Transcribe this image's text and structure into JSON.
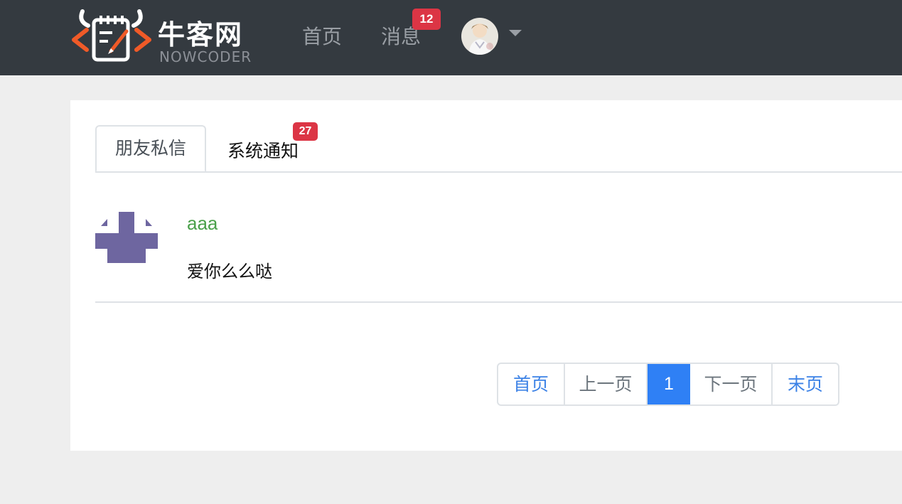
{
  "brand": {
    "name_cn": "牛客网",
    "name_en": "NOWCODER",
    "colors": {
      "orange": "#f05a28",
      "white": "#ffffff"
    }
  },
  "nav": {
    "home_label": "首页",
    "messages_label": "消息",
    "messages_badge": "12"
  },
  "tabs": {
    "letters_label": "朋友私信",
    "notices_label": "系统通知",
    "notices_badge": "27"
  },
  "messages": [
    {
      "user": "aaa",
      "content": "爱你么么哒"
    }
  ],
  "pagination": {
    "first": "首页",
    "prev": "上一页",
    "current": "1",
    "next": "下一页",
    "last": "末页"
  },
  "colors": {
    "navbar_bg": "#343a40",
    "page_bg": "#eeeeee",
    "badge": "#dc3545",
    "link_blue": "#3c82e6",
    "active_page": "#2f80f5",
    "username_green": "#4aa04a",
    "identicon": "#6e66a0"
  }
}
